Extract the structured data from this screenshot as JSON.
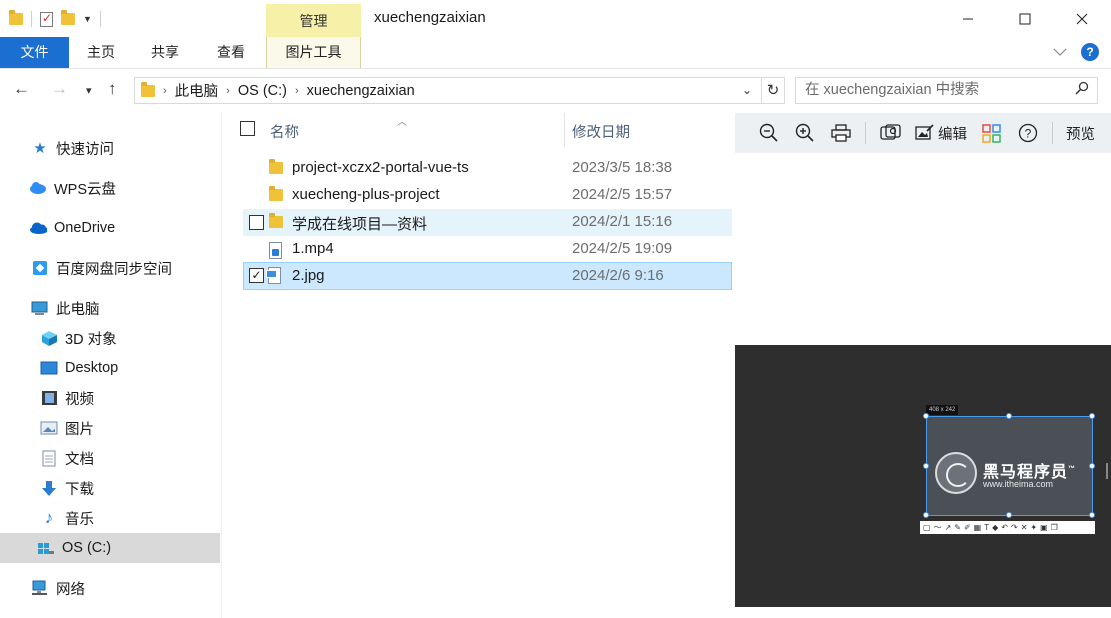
{
  "window": {
    "title": "xuechengzaixian",
    "context_tab": "管理"
  },
  "ribbon": {
    "tabs": [
      "文件",
      "主页",
      "共享",
      "查看",
      "图片工具"
    ]
  },
  "address": {
    "path": [
      "此电脑",
      "OS (C:)",
      "xuechengzaixian"
    ],
    "search_placeholder": "在 xuechengzaixian 中搜索"
  },
  "nav": {
    "items": [
      {
        "label": "快速访问",
        "icon": "star-icon"
      },
      {
        "label": "WPS云盘",
        "icon": "cloud-icon"
      },
      {
        "label": "OneDrive",
        "icon": "onedrive-icon"
      },
      {
        "label": "百度网盘同步空间",
        "icon": "baidu-netdisk-icon"
      },
      {
        "label": "此电脑",
        "icon": "computer-icon"
      },
      {
        "label": "3D 对象",
        "icon": "3d-objects-icon"
      },
      {
        "label": "Desktop",
        "icon": "desktop-icon"
      },
      {
        "label": "视频",
        "icon": "video-icon"
      },
      {
        "label": "图片",
        "icon": "pictures-icon"
      },
      {
        "label": "文档",
        "icon": "documents-icon"
      },
      {
        "label": "下载",
        "icon": "download-icon"
      },
      {
        "label": "音乐",
        "icon": "music-icon"
      },
      {
        "label": "OS (C:)",
        "icon": "drive-icon",
        "selected": true
      },
      {
        "label": "网络",
        "icon": "network-icon"
      }
    ]
  },
  "list": {
    "headers": {
      "name": "名称",
      "date": "修改日期"
    },
    "rows": [
      {
        "name": "project-xczx2-portal-vue-ts",
        "date": "2023/3/5 18:38",
        "type": "folder"
      },
      {
        "name": "xuecheng-plus-project",
        "date": "2024/2/5 15:57",
        "type": "folder"
      },
      {
        "name": "学成在线项目—资料",
        "date": "2024/2/1 15:16",
        "type": "folder",
        "state": "hover"
      },
      {
        "name": "1.mp4",
        "date": "2024/2/5 19:09",
        "type": "mp4"
      },
      {
        "name": "2.jpg",
        "date": "2024/2/6 9:16",
        "type": "jpg",
        "state": "selected"
      }
    ]
  },
  "preview": {
    "toolbar": {
      "edit_label": "编辑",
      "preview_label": "预览"
    },
    "image": {
      "size_label": "408 x 242",
      "logo_text": "黑马程序员",
      "trademark": "™",
      "url": "www.itheima.com"
    }
  }
}
